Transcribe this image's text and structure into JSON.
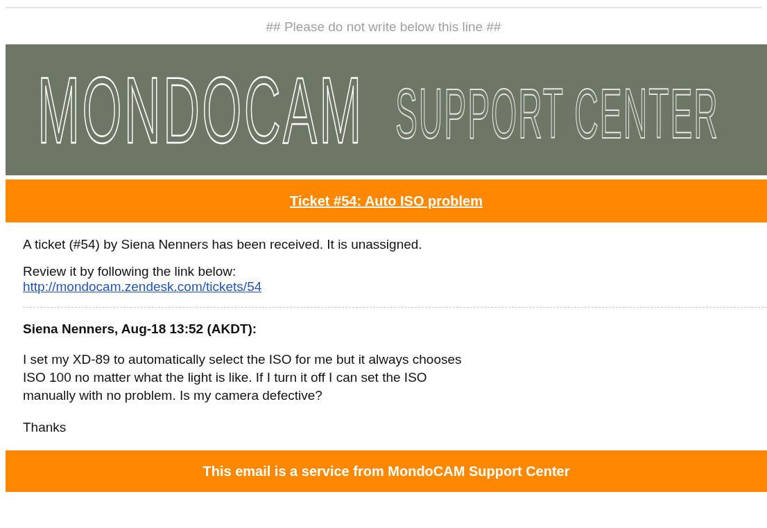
{
  "notice": "## Please do not write below this line ##",
  "banner": {
    "brand": "MONDOCAM",
    "subtitle": "SUPPORT CENTER"
  },
  "ticket_title": "Ticket #54: Auto ISO problem",
  "intro": "A ticket (#54) by Siena Nenners has been received. It is unassigned.",
  "review_text": "Review it by following the link below:",
  "review_link": "http://mondocam.zendesk.com/tickets/54",
  "comment": {
    "author_line": "Siena Nenners, Aug-18 13:52 (AKDT):",
    "lines": [
      "I set my XD-89 to automatically select the ISO for me but it always chooses",
      "ISO 100 no matter what the light is like. If I turn it off I can set the ISO",
      "manually with no problem. Is my camera defective?"
    ],
    "signoff": "Thanks"
  },
  "footer": "This email is a service from MondoCAM Support Center"
}
